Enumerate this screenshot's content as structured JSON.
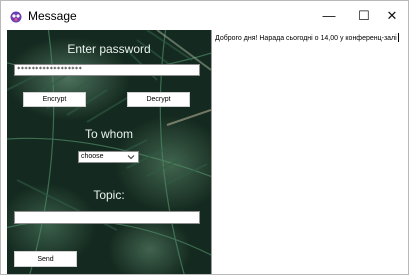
{
  "window": {
    "title": "Message",
    "app_icon": "app-icon",
    "controls": {
      "minimize": "—",
      "maximize": "☐",
      "close": "✕"
    }
  },
  "form": {
    "password_label": "Enter password",
    "password_value": "******************",
    "encrypt_label": "Encrypt",
    "decrypt_label": "Decrypt",
    "whom_label": "To whom",
    "whom_selected": "choose",
    "topic_label": "Topic:",
    "topic_value": "",
    "send_label": "Send"
  },
  "message": {
    "text": "Доброго дня! Нарада сьогодні о 14,00 у конференц-залі"
  },
  "colors": {
    "background_dark": "#14291f",
    "label": "#e9f2ee"
  }
}
